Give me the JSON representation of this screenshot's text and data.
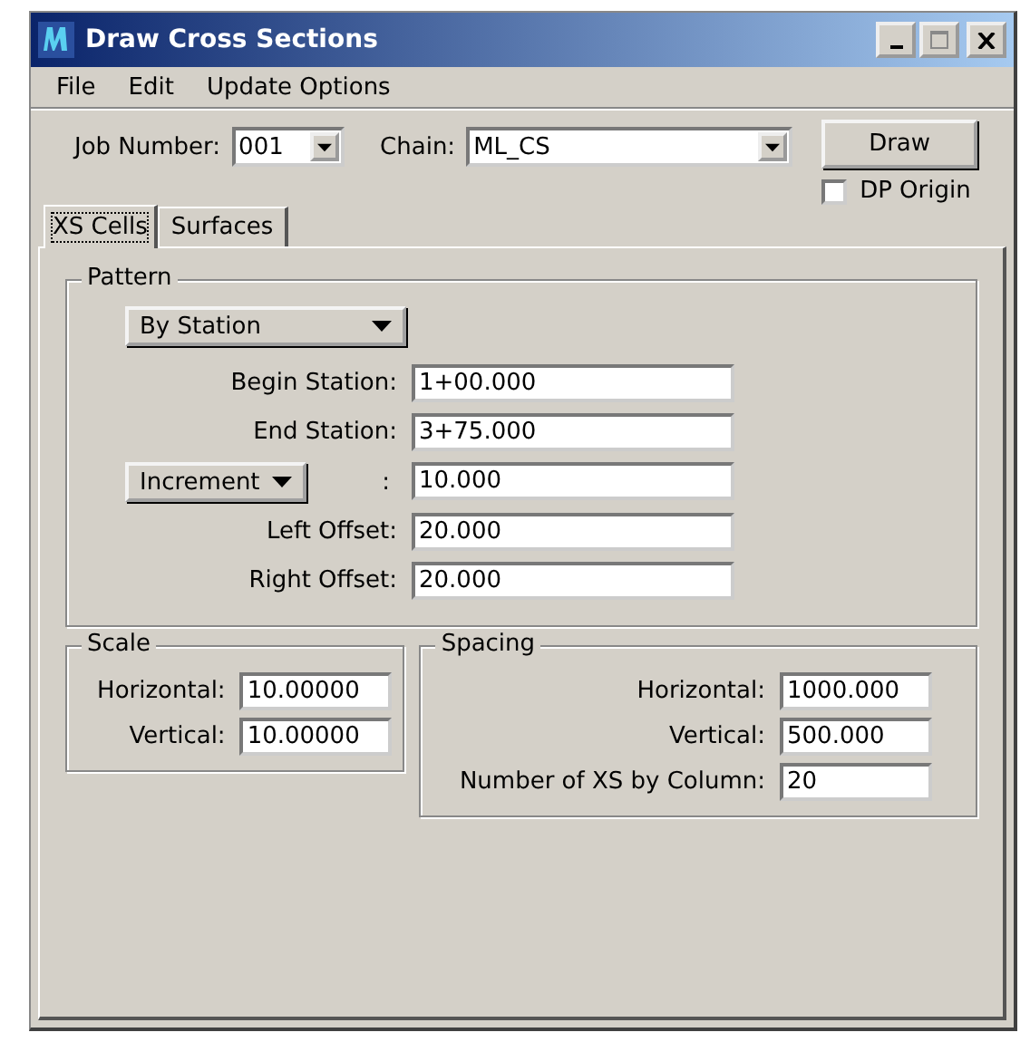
{
  "window": {
    "title": "Draw Cross Sections"
  },
  "menu": [
    "File",
    "Edit",
    "Update Options"
  ],
  "job_number": {
    "label": "Job Number:",
    "value": "001"
  },
  "chain": {
    "label": "Chain:",
    "value": "ML_CS"
  },
  "draw_button": "Draw",
  "dp_origin": {
    "label": "DP Origin",
    "checked": false
  },
  "tabs": [
    {
      "label": "XS Cells",
      "selected": true
    },
    {
      "label": "Surfaces",
      "selected": false
    }
  ],
  "pattern": {
    "title": "Pattern",
    "mode": "By Station",
    "fields": [
      {
        "kind": "label",
        "label": "Begin Station:",
        "value": "1+00.000"
      },
      {
        "kind": "label",
        "label": "End Station:",
        "value": "3+75.000"
      },
      {
        "kind": "dropdown",
        "label": "Increment",
        "separator": ":",
        "value": "10.000"
      },
      {
        "kind": "label",
        "label": "Left Offset:",
        "value": "20.000"
      },
      {
        "kind": "label",
        "label": "Right Offset:",
        "value": "20.000"
      }
    ]
  },
  "scale": {
    "title": "Scale",
    "fields": [
      {
        "label": "Horizontal:",
        "value": "10.00000"
      },
      {
        "label": "Vertical:",
        "value": "10.00000"
      }
    ]
  },
  "spacing": {
    "title": "Spacing",
    "fields": [
      {
        "label": "Horizontal:",
        "value": "1000.000"
      },
      {
        "label": "Vertical:",
        "value": "500.000"
      },
      {
        "label": "Number of XS by Column:",
        "value": "20"
      }
    ]
  }
}
